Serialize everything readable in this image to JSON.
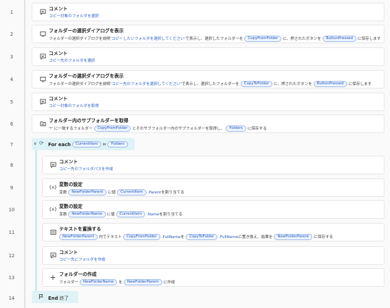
{
  "lines": [
    "1",
    "2",
    "3",
    "4",
    "5",
    "6",
    "7",
    "8",
    "9",
    "10",
    "11",
    "12",
    "13",
    "14"
  ],
  "steps": {
    "s1": {
      "title": "コメント",
      "text": "コピー対象のフォルダを選択"
    },
    "s2": {
      "title": "フォルダーの選択ダイアログを表示",
      "p1": "フォルダーの選択ダイアログを説明 ",
      "q": "'コピーしたいフォルダを選択してください'",
      "p2": " で表示し、選択したフォルダーを",
      "t1": "CopyFromFolder",
      "p3": " に、押されたボタンを",
      "t2": "ButtonPressed",
      "p4": " に保存します"
    },
    "s3": {
      "title": "コメント",
      "text": "コピー先のフォルダを選択"
    },
    "s4": {
      "title": "フォルダーの選択ダイアログを表示",
      "p1": "フォルダーの選択ダイアログを説明 ",
      "q": "'コピー先のフォルダを選択してください'",
      "p2": " で表示し、選択したフォルダーを",
      "t1": "CopyToFolder",
      "p3": " に、押されたボタンを",
      "t2": "ButtonPressed",
      "p4": " に保存します"
    },
    "s5": {
      "title": "コメント",
      "text": "コピー対象のフォルダを取得"
    },
    "s6": {
      "title": "フォルダー内のサブフォルダーを取得",
      "p1": "'*' に一致するフォルダー",
      "t1": "CopyFromFolder",
      "p2": " とそのサブフォルダー内のサブフォルダーを取得し、",
      "t2": "Folders",
      "p3": " に保存する"
    },
    "s7": {
      "kw": "For each",
      "t1": "CurrentItem",
      "in": "in",
      "t2": "Folders"
    },
    "s8": {
      "title": "コメント",
      "text": "コピー先のフォルダパスを作成"
    },
    "s9": {
      "title": "変数の設定",
      "p1": "変数",
      "t1": "NewFolderParent",
      "p2": " に値",
      "t2": "CurrentItem",
      "prop": ".Parent",
      "p3": " を割り当てる"
    },
    "s10": {
      "title": "変数の設定",
      "p1": "変数",
      "t1": "NewFolderName",
      "p2": " に値",
      "t2": "CurrentItem",
      "prop": ".Name",
      "p3": " を割り当てる"
    },
    "s11": {
      "title": "テキストを置換する",
      "t1": "NewFolderParent",
      "p1": " 内でテキスト",
      "t2": "CopyFromFolder",
      "prop1": ".FullName",
      "p2": " を",
      "t3": "CopyToFolder",
      "prop2": ".FullName",
      "p3": " に置き換え、結果を",
      "t4": "NewFolderParent",
      "p4": " に保存する"
    },
    "s12": {
      "title": "コメント",
      "text": "コピー先にフォルダを作成"
    },
    "s13": {
      "title": "フォルダーの作成",
      "p1": "フォルダー",
      "t1": "NewFolderName",
      "p2": " を",
      "t2": "NewFolderParent",
      "p3": " に作成"
    },
    "s14": {
      "kw": "End",
      "sub": "終了"
    }
  },
  "icons": {
    "comment": "comment-icon",
    "folder_dialog": "folder-dialog-icon",
    "folder_list": "folder-list-icon",
    "loop": "loop-icon",
    "variable": "variable-icon",
    "replace": "text-replace-icon",
    "add": "plus-icon",
    "flag": "flag-icon"
  },
  "colors": {
    "accent": "#1f56b8",
    "loop_bg": "#dff3f7",
    "token_bg": "#eef4ff"
  }
}
